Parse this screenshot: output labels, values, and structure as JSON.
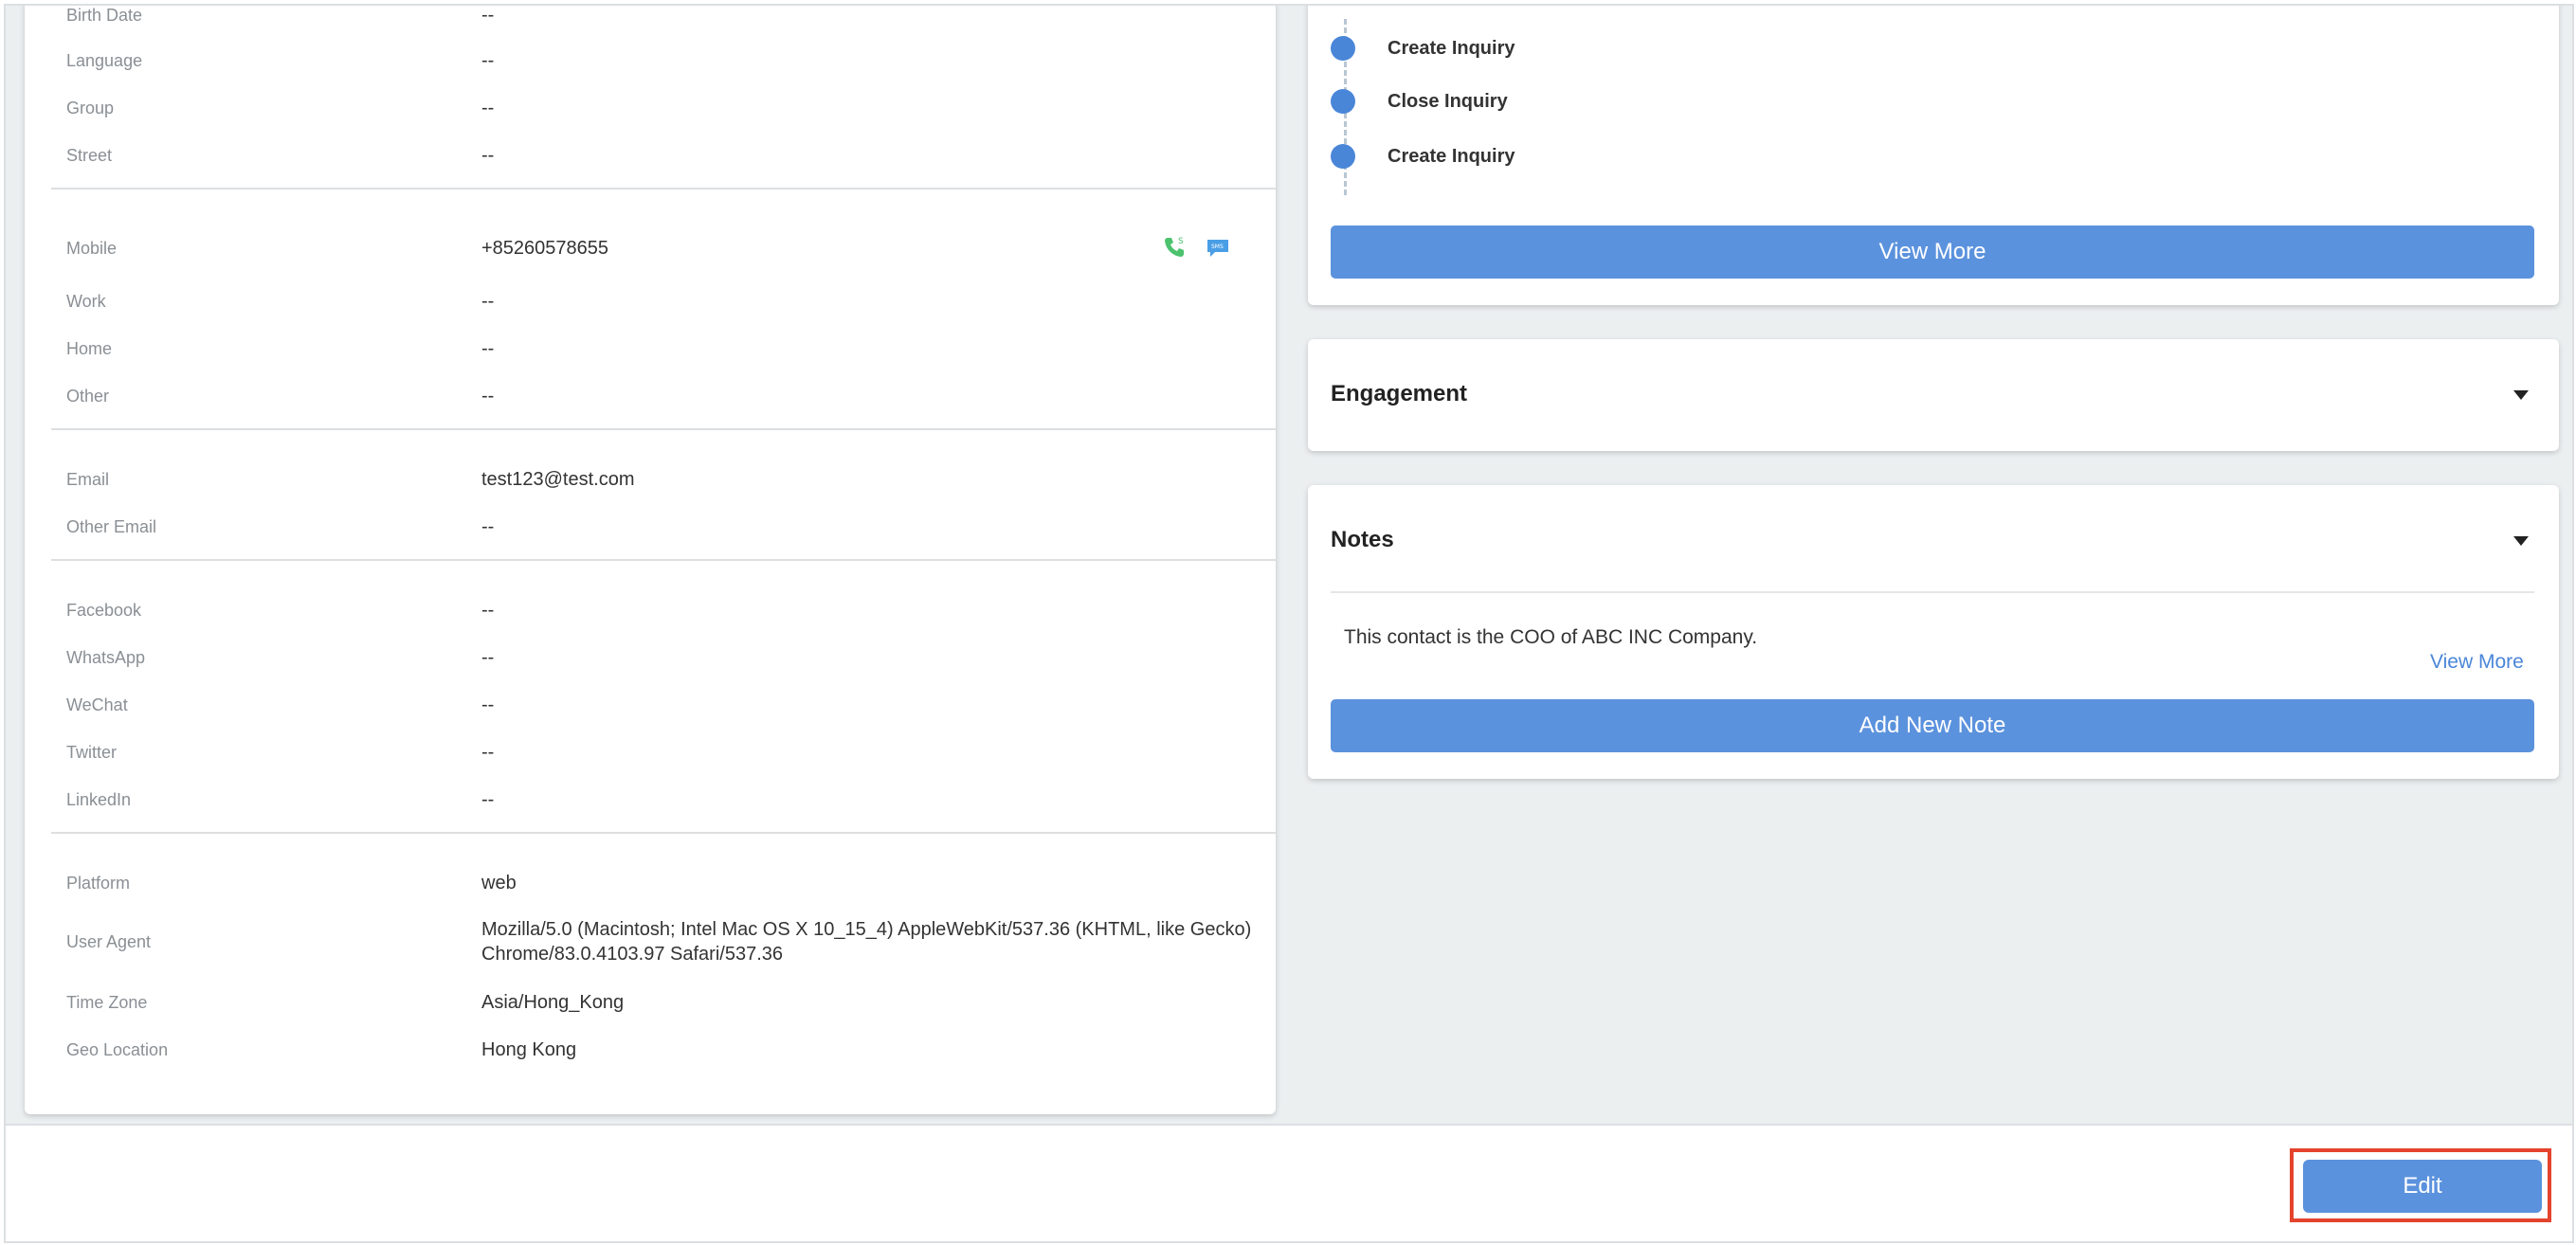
{
  "profile": {
    "fields_top": [
      {
        "label": "Birth Date",
        "value": "--"
      },
      {
        "label": "Language",
        "value": "--"
      },
      {
        "label": "Group",
        "value": "--"
      },
      {
        "label": "Street",
        "value": "--"
      }
    ],
    "phones": [
      {
        "label": "Mobile",
        "value": "+85260578655"
      },
      {
        "label": "Work",
        "value": "--"
      },
      {
        "label": "Home",
        "value": "--"
      },
      {
        "label": "Other",
        "value": "--"
      }
    ],
    "emails": [
      {
        "label": "Email",
        "value": "test123@test.com"
      },
      {
        "label": "Other Email",
        "value": "--"
      }
    ],
    "social": [
      {
        "label": "Facebook",
        "value": "--"
      },
      {
        "label": "WhatsApp",
        "value": "--"
      },
      {
        "label": "WeChat",
        "value": "--"
      },
      {
        "label": "Twitter",
        "value": "--"
      },
      {
        "label": "LinkedIn",
        "value": "--"
      }
    ],
    "system": [
      {
        "label": "Platform",
        "value": "web"
      },
      {
        "label": "User Agent",
        "value": "Mozilla/5.0 (Macintosh; Intel Mac OS X 10_15_4) AppleWebKit/537.36 (KHTML, like Gecko) Chrome/83.0.4103.97 Safari/537.36"
      },
      {
        "label": "Time Zone",
        "value": "Asia/Hong_Kong"
      },
      {
        "label": "Geo Location",
        "value": "Hong Kong"
      }
    ],
    "icons": {
      "call": "phone-call-icon",
      "sms": "sms-icon"
    },
    "icon_colors": {
      "call": "#4cc26e",
      "sms": "#4a9ee6"
    }
  },
  "activity": {
    "items": [
      "Create Inquiry",
      "Close Inquiry",
      "Create Inquiry"
    ],
    "view_more_label": "View More"
  },
  "engagement": {
    "title": "Engagement"
  },
  "notes": {
    "title": "Notes",
    "text": "This contact is the COO of ABC INC Company.",
    "view_more_label": "View More",
    "add_label": "Add New Note"
  },
  "footer": {
    "edit_label": "Edit"
  },
  "colors": {
    "accent": "#5b92dd",
    "highlight": "#e4432d"
  }
}
